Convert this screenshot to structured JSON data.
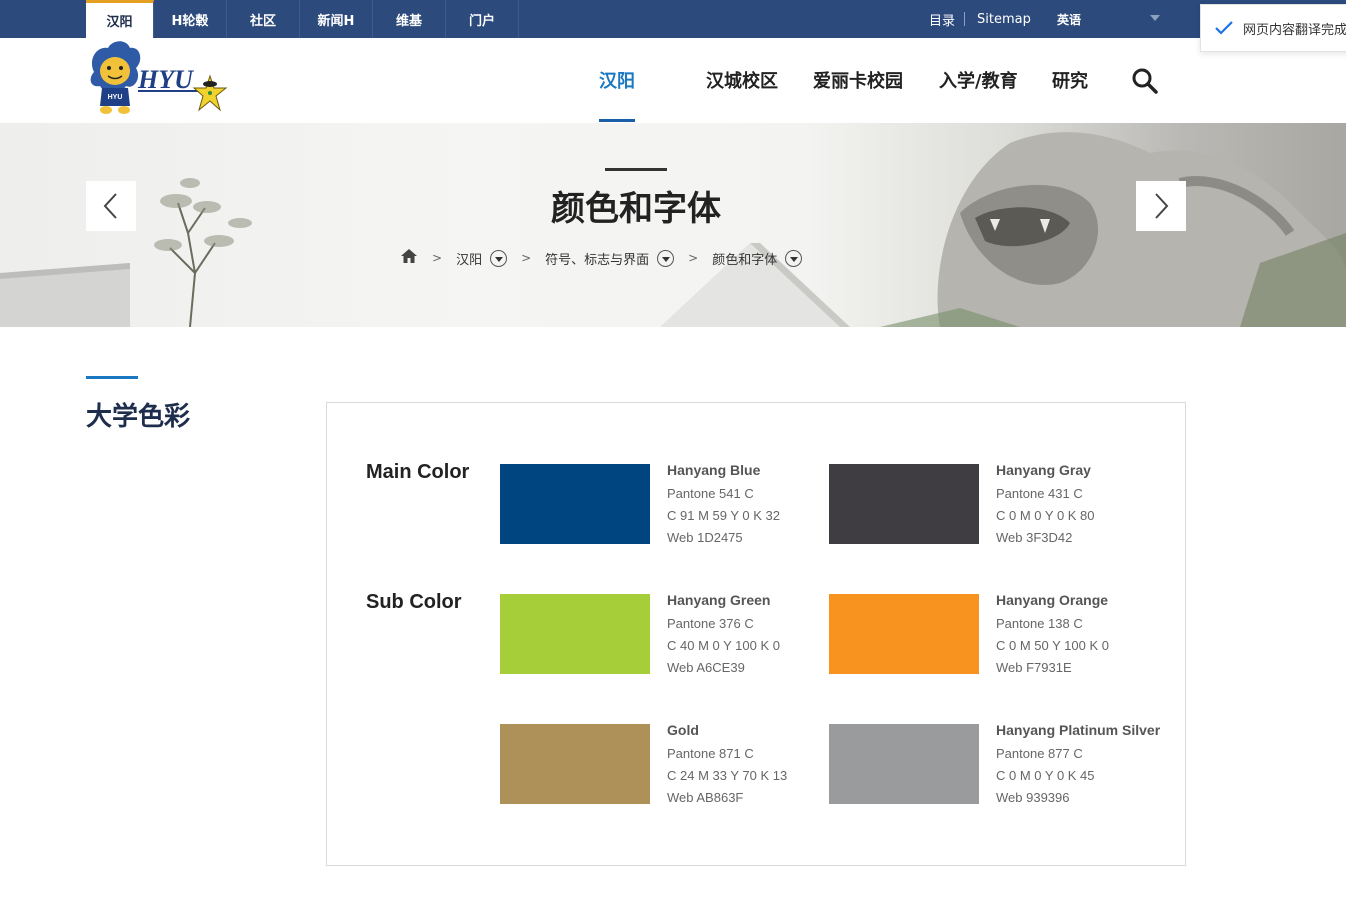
{
  "topbar": {
    "tabs": [
      {
        "label": "汉阳",
        "active": true
      },
      {
        "label": "H轮毂"
      },
      {
        "label": "社区"
      },
      {
        "label": "新闻H"
      },
      {
        "label": "维基"
      },
      {
        "label": "门户"
      }
    ],
    "sitemap_cn": "目录",
    "sitemap_en": "Sitemap",
    "language": "英语"
  },
  "translate_notice": "网页内容翻译完成",
  "logo": {
    "text": "HYU",
    "mascot_text": "HYU"
  },
  "nav": {
    "items": [
      "汉阳",
      "汉城校区",
      "爱丽卡校园",
      "入学/教育",
      "研究"
    ],
    "active_index": 0
  },
  "banner": {
    "title": "颜色和字体",
    "breadcrumb": [
      "汉阳",
      "符号、标志与界面",
      "颜色和字体"
    ]
  },
  "section": {
    "title": "大学色彩",
    "main_label": "Main Color",
    "sub_label": "Sub Color",
    "colors": [
      {
        "name": "Hanyang Blue",
        "pantone": "Pantone 541 C",
        "cmyk": "C 91  M 59  Y 0  K 32",
        "web": "Web 1D2475",
        "hex": "#00457F"
      },
      {
        "name": "Hanyang Gray",
        "pantone": "Pantone 431 C",
        "cmyk": "C 0  M 0  Y 0  K 80",
        "web": "Web 3F3D42",
        "hex": "#3F3D42"
      },
      {
        "name": "Hanyang Green",
        "pantone": "Pantone 376 C",
        "cmyk": "C 40  M 0  Y 100  K 0",
        "web": "Web A6CE39",
        "hex": "#A6CE39"
      },
      {
        "name": "Hanyang Orange",
        "pantone": "Pantone 138 C",
        "cmyk": "C 0  M 50  Y 100  K 0",
        "web": "Web F7931E",
        "hex": "#F7931E"
      },
      {
        "name": "Gold",
        "pantone": "Pantone 871 C",
        "cmyk": "C 24  M 33  Y 70  K 13",
        "web": "Web AB863F",
        "hex": "#AE9159"
      },
      {
        "name": "Hanyang Platinum Silver",
        "pantone": "Pantone 877 C",
        "cmyk": "C 0  M 0  Y 0  K 45",
        "web": "Web 939396",
        "hex": "#9A9B9D"
      }
    ]
  }
}
